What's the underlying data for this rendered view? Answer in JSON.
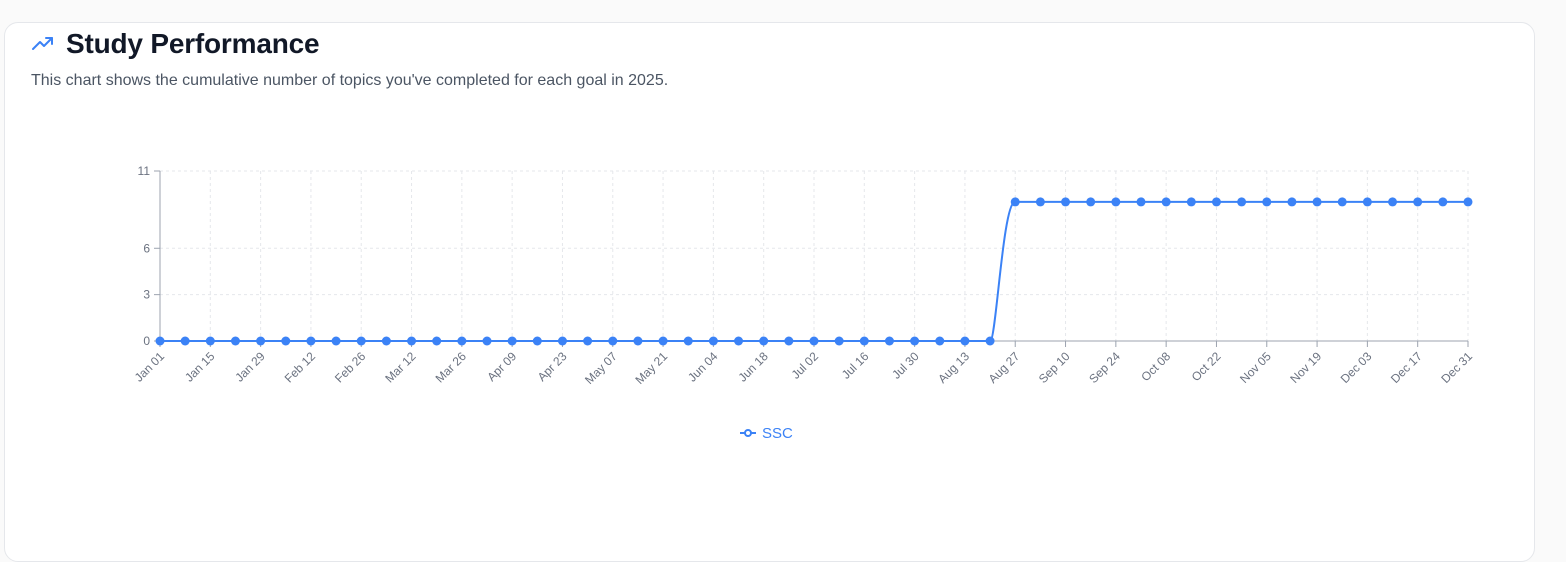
{
  "header": {
    "icon": "trending-up-icon",
    "title": "Study Performance",
    "subtitle": "This chart shows the cumulative number of topics you've completed for each goal in 2025."
  },
  "colors": {
    "series": "#3b82f6",
    "grid": "#e5e7eb",
    "axis": "#9ca3af",
    "tick_text": "#6b7280"
  },
  "legend": {
    "label": "SSC",
    "icon": "line-dot-icon"
  },
  "chart_data": {
    "type": "line",
    "title": "",
    "xlabel": "",
    "ylabel": "",
    "ylim": [
      0,
      11
    ],
    "y_ticks": [
      0,
      3,
      6,
      11
    ],
    "grid": true,
    "legend_position": "bottom-center",
    "x_tick_labels": [
      "Jan 01",
      "Jan 15",
      "Jan 29",
      "Feb 12",
      "Feb 26",
      "Mar 12",
      "Mar 26",
      "Apr 09",
      "Apr 23",
      "May 07",
      "May 21",
      "Jun 04",
      "Jun 18",
      "Jul 02",
      "Jul 16",
      "Jul 30",
      "Aug 13",
      "Aug 27",
      "Sep 10",
      "Sep 24",
      "Oct 08",
      "Oct 22",
      "Nov 05",
      "Nov 19",
      "Dec 03",
      "Dec 17",
      "Dec 31"
    ],
    "x": [
      "Jan 01",
      "Jan 08",
      "Jan 15",
      "Jan 22",
      "Jan 29",
      "Feb 05",
      "Feb 12",
      "Feb 19",
      "Feb 26",
      "Mar 05",
      "Mar 12",
      "Mar 19",
      "Mar 26",
      "Apr 02",
      "Apr 09",
      "Apr 16",
      "Apr 23",
      "Apr 30",
      "May 07",
      "May 14",
      "May 21",
      "May 28",
      "Jun 04",
      "Jun 11",
      "Jun 18",
      "Jun 25",
      "Jul 02",
      "Jul 09",
      "Jul 16",
      "Jul 23",
      "Jul 30",
      "Aug 06",
      "Aug 13",
      "Aug 20",
      "Aug 27",
      "Sep 03",
      "Sep 10",
      "Sep 17",
      "Sep 24",
      "Oct 01",
      "Oct 08",
      "Oct 15",
      "Oct 22",
      "Oct 29",
      "Nov 05",
      "Nov 12",
      "Nov 19",
      "Nov 26",
      "Dec 03",
      "Dec 10",
      "Dec 17",
      "Dec 24",
      "Dec 31"
    ],
    "series": [
      {
        "name": "SSC",
        "values": [
          0,
          0,
          0,
          0,
          0,
          0,
          0,
          0,
          0,
          0,
          0,
          0,
          0,
          0,
          0,
          0,
          0,
          0,
          0,
          0,
          0,
          0,
          0,
          0,
          0,
          0,
          0,
          0,
          0,
          0,
          0,
          0,
          0,
          0,
          9,
          9,
          9,
          9,
          9,
          9,
          9,
          9,
          9,
          9,
          9,
          9,
          9,
          9,
          9,
          9,
          9,
          9,
          9
        ]
      }
    ]
  }
}
